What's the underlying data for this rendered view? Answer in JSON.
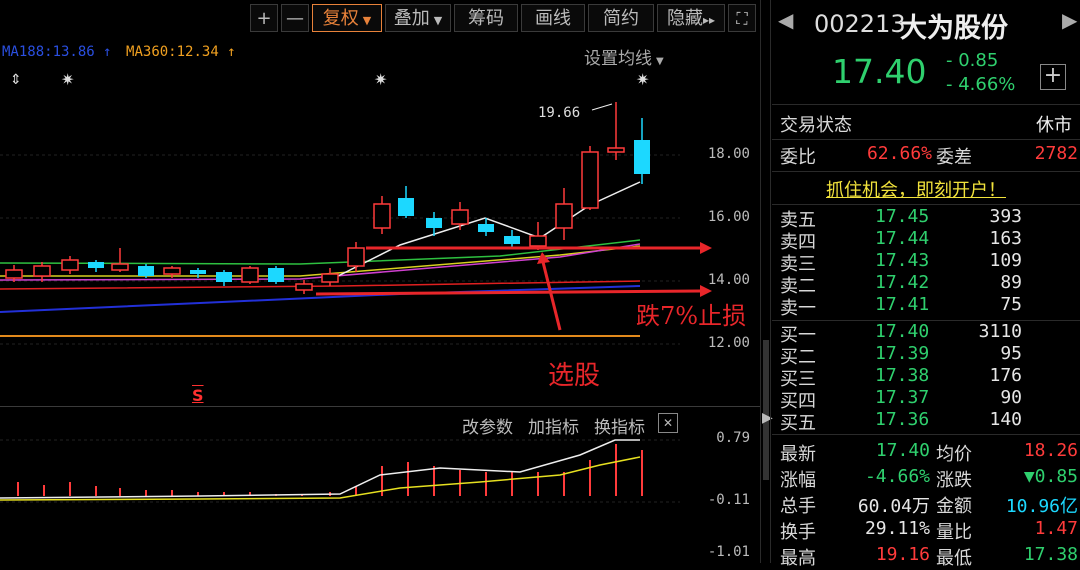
{
  "toolbar": {
    "plus": "+",
    "minus": "—",
    "fuquan": "复权",
    "diejia": "叠加",
    "chouma": "筹码",
    "huaxian": "画线",
    "jianyue": "简约",
    "yincang": "隐藏",
    "yincang_arrow": "▸▸",
    "expand": "⛶"
  },
  "ma_legend": {
    "ma_blue": "MA188:13.86",
    "ma_blue_arrow": "↑",
    "ma_orange": "MA360:12.34",
    "ma_orange_arrow": "↑"
  },
  "settings_link": "设置均线",
  "chart": {
    "y_ticks": [
      "18.00",
      "16.00",
      "14.00",
      "12.00"
    ],
    "high_label": "19.66",
    "buy_marker": "S",
    "annotation_stop": "跌7%止损",
    "annotation_pick": "选股",
    "colors": {
      "up": "#ff3b3b",
      "down": "#1cd8ff",
      "annotation": "#e8262a"
    }
  },
  "indicator": {
    "change_params": "改参数",
    "add_indicator": "加指标",
    "switch_indicator": "换指标",
    "close": "✕",
    "y_ticks": [
      "0.79",
      "-0.11",
      "-1.01"
    ]
  },
  "stock": {
    "code": "002213",
    "name": "大为股份",
    "price": "17.40",
    "change": "- 0.85",
    "change_pct": "- 4.66%",
    "add": "+",
    "status_label": "交易状态",
    "status_value": "休市",
    "weibi_label": "委比",
    "weibi_value": "62.66%",
    "weicha_label": "委差",
    "weicha_value": "2782",
    "promo": "抓住机会，即刻开户！"
  },
  "orderbook": {
    "sell": [
      {
        "label": "卖五",
        "price": "17.45",
        "vol": "393"
      },
      {
        "label": "卖四",
        "price": "17.44",
        "vol": "163"
      },
      {
        "label": "卖三",
        "price": "17.43",
        "vol": "109"
      },
      {
        "label": "卖二",
        "price": "17.42",
        "vol": "89"
      },
      {
        "label": "卖一",
        "price": "17.41",
        "vol": "75"
      }
    ],
    "buy": [
      {
        "label": "买一",
        "price": "17.40",
        "vol": "3110"
      },
      {
        "label": "买二",
        "price": "17.39",
        "vol": "95"
      },
      {
        "label": "买三",
        "price": "17.38",
        "vol": "176"
      },
      {
        "label": "买四",
        "price": "17.37",
        "vol": "90"
      },
      {
        "label": "买五",
        "price": "17.36",
        "vol": "140"
      }
    ]
  },
  "stats": [
    {
      "l1": "最新",
      "v1": "17.40",
      "l2": "均价",
      "v2": "18.26"
    },
    {
      "l1": "涨幅",
      "v1": "-4.66%",
      "l2": "涨跌",
      "v2": "▼0.85"
    },
    {
      "l1": "总手",
      "v1": "60.04万",
      "l2": "金额",
      "v2": "10.96亿"
    },
    {
      "l1": "换手",
      "v1": "29.11%",
      "l2": "量比",
      "v2": "1.47"
    },
    {
      "l1": "最高",
      "v1": "19.16",
      "l2": "最低",
      "v2": "17.38"
    }
  ]
}
